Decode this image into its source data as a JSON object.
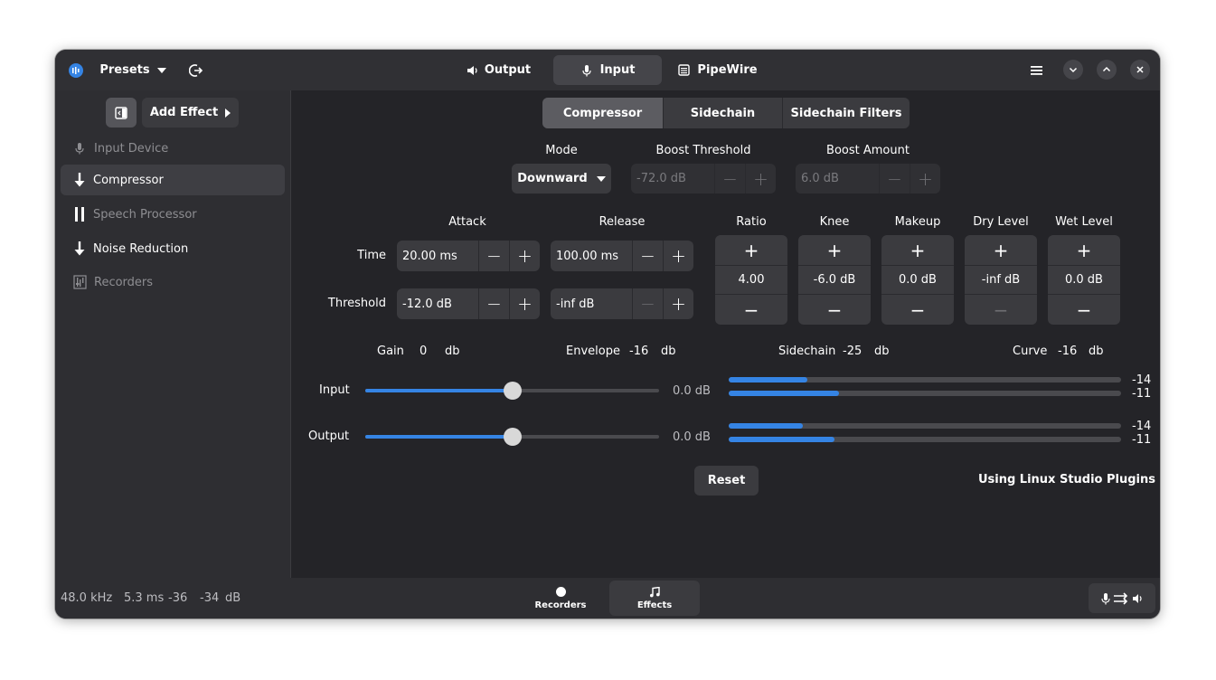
{
  "header": {
    "presets_label": "Presets",
    "tabs": [
      {
        "label": "Output",
        "icon": "speaker-icon"
      },
      {
        "label": "Input",
        "icon": "microphone-icon",
        "active": true
      },
      {
        "label": "PipeWire",
        "icon": "pipewire-icon"
      }
    ]
  },
  "sidebar": {
    "add_effect_label": "Add Effect",
    "items": [
      {
        "label": "Input Device",
        "icon": "microphone-icon",
        "enabled": false
      },
      {
        "label": "Compressor",
        "icon": "arrow-down-icon",
        "selected": true
      },
      {
        "label": "Speech Processor",
        "icon": "pause-icon",
        "enabled": false
      },
      {
        "label": "Noise Reduction",
        "icon": "arrow-down-icon"
      },
      {
        "label": "Recorders",
        "icon": "recorders-icon",
        "enabled": false
      }
    ]
  },
  "plugin_tabs": [
    "Compressor",
    "Sidechain",
    "Sidechain Filters"
  ],
  "mode": {
    "label": "Mode",
    "value": "Downward"
  },
  "boost_threshold": {
    "label": "Boost Threshold",
    "value": "-72.0 dB"
  },
  "boost_amount": {
    "label": "Boost Amount",
    "value": "6.0 dB"
  },
  "grid": {
    "attack_label": "Attack",
    "release_label": "Release",
    "time_label": "Time",
    "threshold_label": "Threshold",
    "attack_time": "20.00 ms",
    "release_time": "100.00 ms",
    "attack_threshold": "-12.0 dB",
    "release_threshold": "-inf dB"
  },
  "knobs": [
    {
      "label": "Ratio",
      "value": "4.00"
    },
    {
      "label": "Knee",
      "value": "-6.0 dB"
    },
    {
      "label": "Makeup",
      "value": "0.0 dB"
    },
    {
      "label": "Dry Level",
      "value": "-inf dB"
    },
    {
      "label": "Wet Level",
      "value": "0.0 dB"
    }
  ],
  "readouts": {
    "gain": {
      "label": "Gain",
      "value": "0",
      "unit": "db"
    },
    "envelope": {
      "label": "Envelope",
      "value": "-16",
      "unit": "db"
    },
    "sidechain": {
      "label": "Sidechain",
      "value": "-25",
      "unit": "db"
    },
    "curve": {
      "label": "Curve",
      "value": "-16",
      "unit": "db"
    }
  },
  "sliders": [
    {
      "label": "Input",
      "value_text": "0.0 dB",
      "fraction": 0.5
    },
    {
      "label": "Output",
      "value_text": "0.0 dB",
      "fraction": 0.5
    }
  ],
  "meters": [
    {
      "fraction": 0.2,
      "label": "-14"
    },
    {
      "fraction": 0.28,
      "label": "-11"
    },
    {
      "fraction": 0.19,
      "label": "-14"
    },
    {
      "fraction": 0.27,
      "label": "-11"
    }
  ],
  "reset_label": "Reset",
  "plugin_note": "Using Linux Studio Plugins",
  "footer": {
    "sample_rate": "48.0 kHz",
    "latency": "5.3 ms",
    "level_left": "-36",
    "level_right": "-34",
    "level_unit": "dB",
    "tabs": [
      {
        "label": "Recorders",
        "icon": "record-icon"
      },
      {
        "label": "Effects",
        "icon": "music-note-icon",
        "active": true
      }
    ]
  },
  "colors": {
    "accent": "#3584e4",
    "window_bg": "#242428",
    "header_bg": "#303034"
  }
}
